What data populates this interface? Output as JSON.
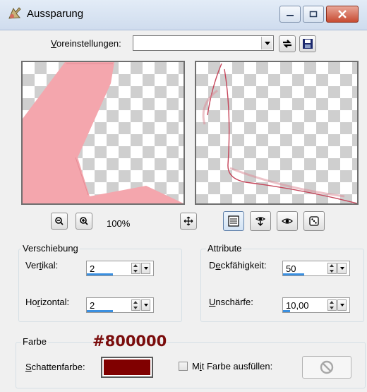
{
  "window": {
    "title": "Aussparung",
    "controls": [
      "minimize-icon",
      "maximize-icon",
      "close-icon"
    ]
  },
  "presets": {
    "label_prefix": "V",
    "label_rest": "oreinstellungen:",
    "value": "",
    "reset_icon": "reset-arrows-icon",
    "save_icon": "floppy-disk-icon"
  },
  "preview": {
    "zoom_level": "100%",
    "zoom_out_icon": "zoom-out-icon",
    "zoom_in_icon": "zoom-in-icon",
    "pan_icon": "pan-move-icon",
    "tool_icons": [
      "view-options-icon",
      "proof-icon",
      "preview-toggle-icon",
      "randomize-dice-icon"
    ],
    "shadow_color": "#f4a6ad",
    "overlay_color": "#c5455a"
  },
  "offset": {
    "title": "Verschiebung",
    "vertical": {
      "label_pre": "Ver",
      "label_u": "t",
      "label_post": "ikal:",
      "value": "2",
      "fill": 0.62
    },
    "horizontal": {
      "label_pre": "Ho",
      "label_u": "r",
      "label_post": "izontal:",
      "value": "2",
      "fill": 0.62
    }
  },
  "attributes": {
    "title": "Attribute",
    "opacity": {
      "label_pre": "D",
      "label_u": "e",
      "label_post": "ckfähigkeit:",
      "value": "50",
      "fill": 0.5
    },
    "blur": {
      "label_pre": "",
      "label_u": "U",
      "label_post": "nschärfe:",
      "value": "10,00",
      "fill": 0.16
    }
  },
  "color": {
    "title": "Farbe",
    "hex_annotation": "#800000",
    "shadow_label_u": "S",
    "shadow_label_rest": "chattenfarbe:",
    "shadow_color": "#800000",
    "fill_label_pre": "M",
    "fill_label_u": "i",
    "fill_label_post": "t Farbe ausfüllen:",
    "fill_checked": false,
    "fill_button_icon": "no-fill-icon"
  },
  "colors": {
    "accent": "#3a8fe0",
    "titlebar": "#dbe6f4",
    "close": "#c74b32"
  }
}
